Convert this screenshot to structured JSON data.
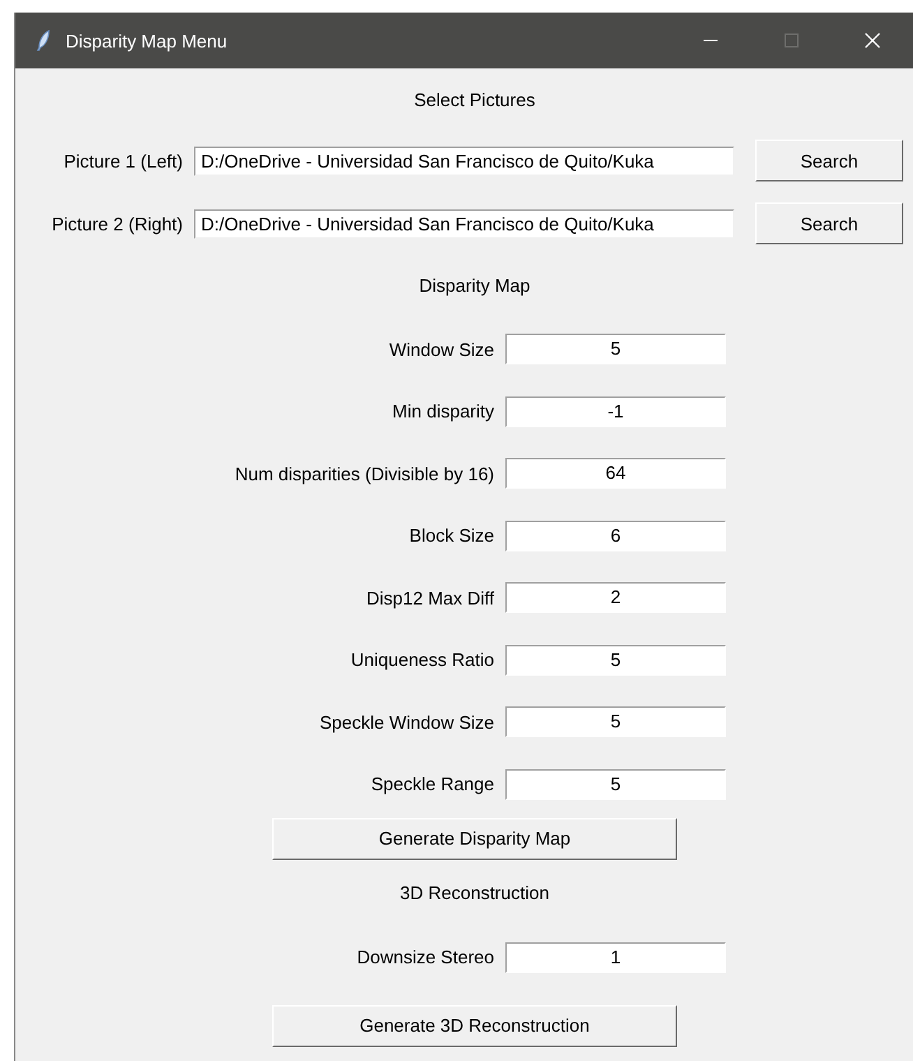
{
  "window": {
    "title": "Disparity Map Menu"
  },
  "pictures": {
    "heading": "Select Pictures",
    "rows": [
      {
        "label": "Picture 1 (Left)",
        "value": "D:/OneDrive - Universidad San Francisco de Quito/Kuka",
        "button": "Search"
      },
      {
        "label": "Picture 2 (Right)",
        "value": "D:/OneDrive - Universidad San Francisco de Quito/Kuka",
        "button": "Search"
      }
    ]
  },
  "disparity_map": {
    "heading": "Disparity Map",
    "params": [
      {
        "label": "Window Size",
        "value": "5"
      },
      {
        "label": "Min disparity",
        "value": "-1"
      },
      {
        "label": "Num disparities (Divisible by 16)",
        "value": "64"
      },
      {
        "label": "Block Size",
        "value": "6"
      },
      {
        "label": "Disp12 Max Diff",
        "value": "2"
      },
      {
        "label": "Uniqueness Ratio",
        "value": "5"
      },
      {
        "label": "Speckle Window Size",
        "value": "5"
      },
      {
        "label": "Speckle Range",
        "value": "5"
      }
    ],
    "button": "Generate Disparity Map"
  },
  "reconstruction": {
    "heading": "3D Reconstruction",
    "params": [
      {
        "label": "Downsize Stereo",
        "value": "1"
      }
    ],
    "button": "Generate 3D Reconstruction"
  }
}
